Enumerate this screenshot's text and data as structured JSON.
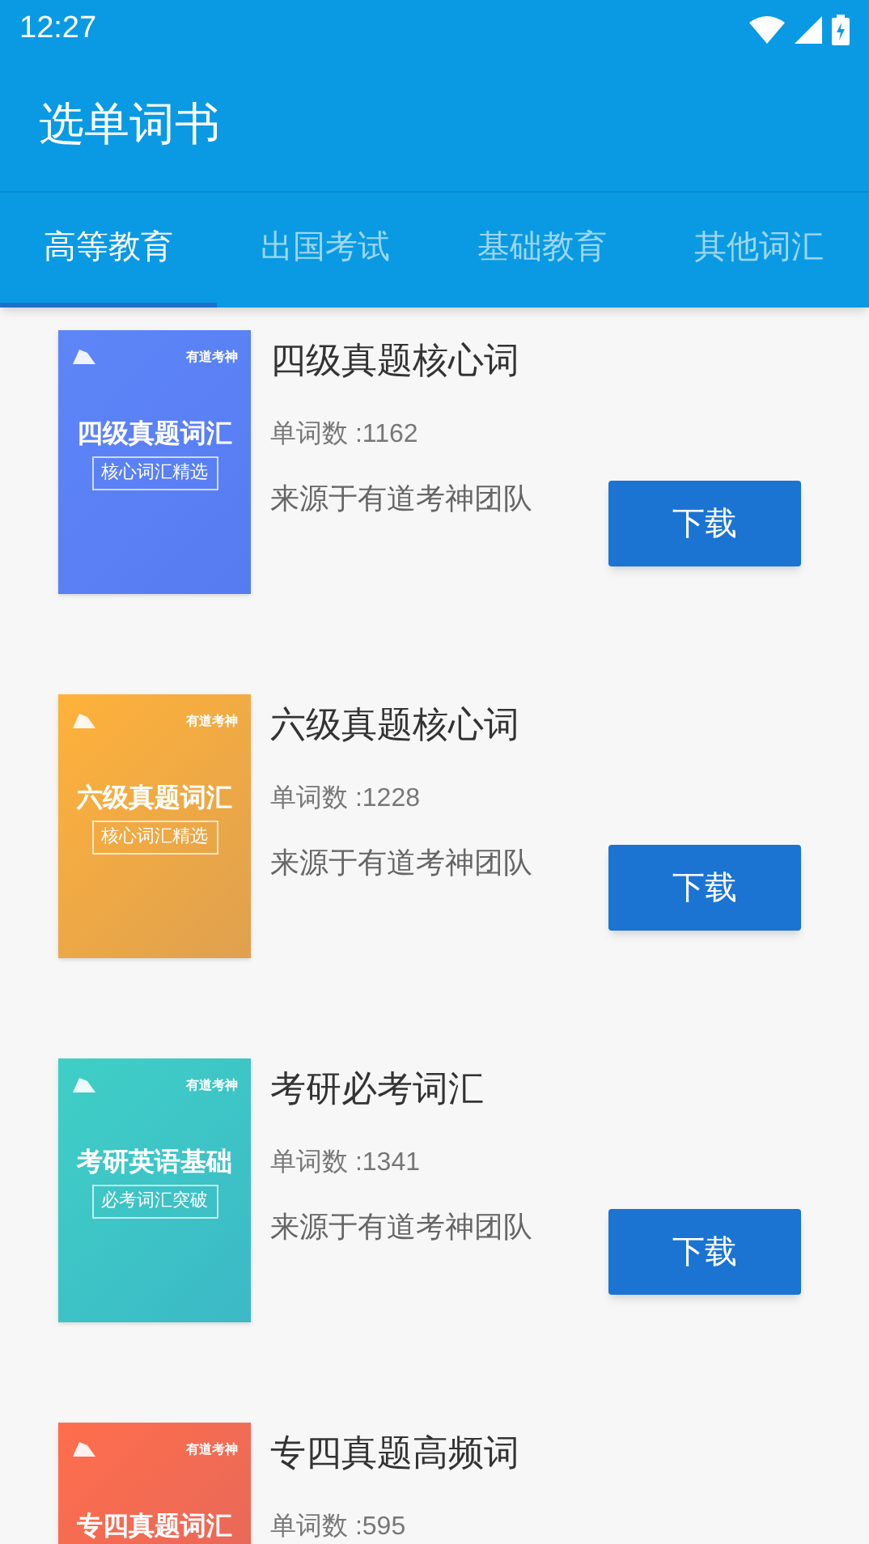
{
  "status_bar": {
    "time": "12:27"
  },
  "app_bar": {
    "title": "选单词书"
  },
  "tabs": [
    {
      "label": "高等教育",
      "selected": true
    },
    {
      "label": "出国考试",
      "selected": false
    },
    {
      "label": "基础教育",
      "selected": false
    },
    {
      "label": "其他词汇",
      "selected": false
    }
  ],
  "books": [
    {
      "title": "四级真题核心词",
      "word_count": "单词数 :1162",
      "source": "来源于有道考神团队",
      "button": "下载",
      "cover": {
        "color": "#5e86f8",
        "brand": "有道考神",
        "title": "四级真题词汇",
        "subtitle": "核心词汇精选"
      }
    },
    {
      "title": "六级真题核心词",
      "word_count": "单词数 :1228",
      "source": "来源于有道考神团队",
      "button": "下载",
      "cover": {
        "color": "#ffb23a",
        "brand": "有道考神",
        "title": "六级真题词汇",
        "subtitle": "核心词汇精选"
      }
    },
    {
      "title": "考研必考词汇",
      "word_count": "单词数 :1341",
      "source": "来源于有道考神团队",
      "button": "下载",
      "cover": {
        "color": "#3fcfc6",
        "brand": "有道考神",
        "title": "考研英语基础",
        "subtitle": "必考词汇突破"
      }
    },
    {
      "title": "专四真题高频词",
      "word_count": "单词数 :595",
      "cover": {
        "color": "#ff6e4c",
        "brand": "有道考神",
        "title": "专四真题词汇"
      }
    }
  ]
}
